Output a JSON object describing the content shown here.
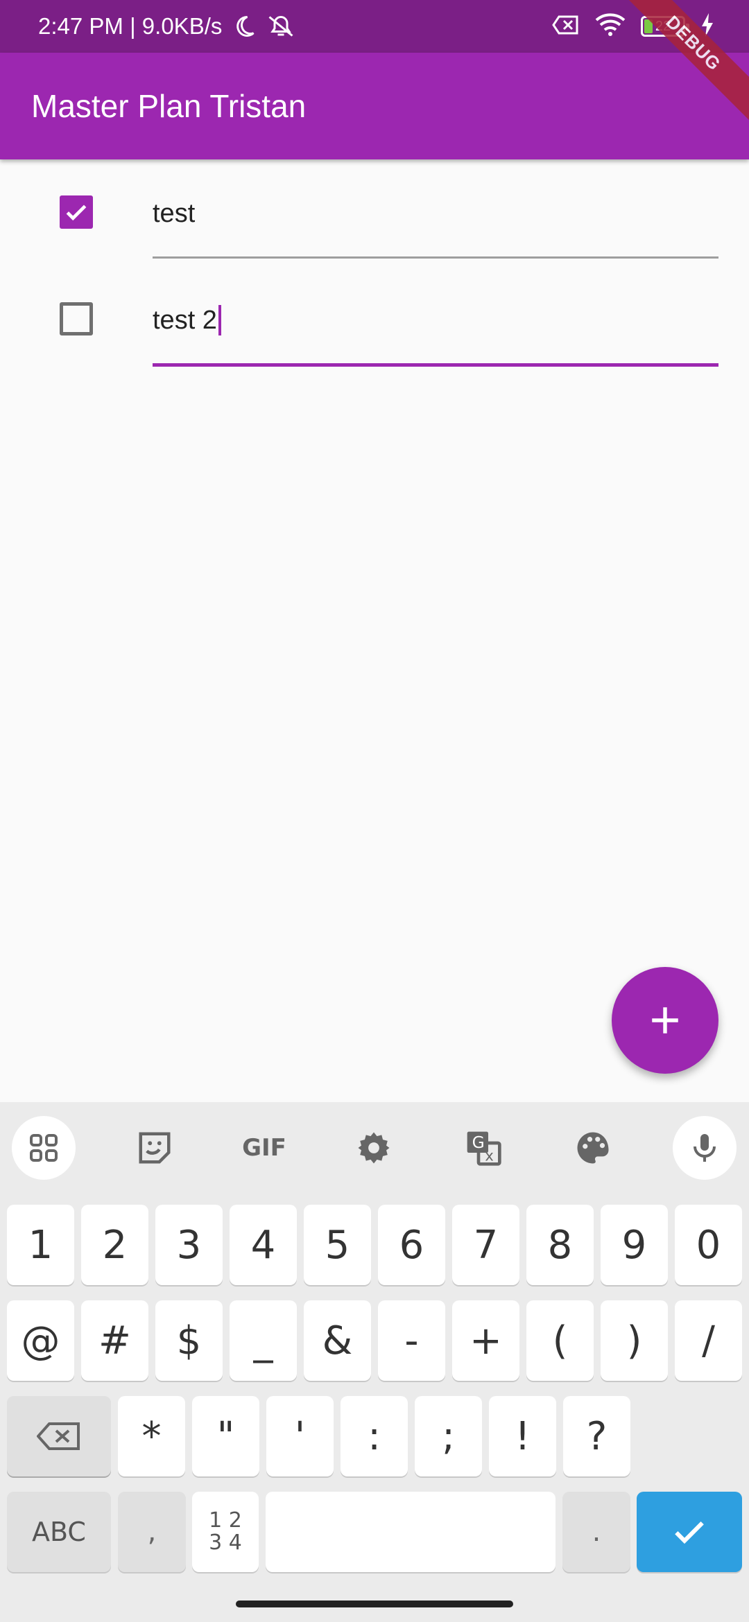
{
  "status_bar": {
    "time_info": "2:47 PM | 9.0KB/s",
    "battery_level": "22",
    "icons": [
      "moon-icon",
      "bell-off-icon",
      "sim-off-icon",
      "wifi-icon",
      "battery-icon",
      "charging-bolt-icon"
    ]
  },
  "debug_banner": "DEBUG",
  "app_bar": {
    "title": "Master Plan Tristan"
  },
  "todos": [
    {
      "text": "test",
      "checked": true
    },
    {
      "text": "test 2",
      "checked": false
    }
  ],
  "fab": {
    "label": "+",
    "icon": "add-icon"
  },
  "keyboard": {
    "toolbar_icons": [
      "apps-grid-icon",
      "sticker-icon",
      "gif-icon",
      "settings-icon",
      "translate-icon",
      "palette-icon",
      "microphone-icon"
    ],
    "gif_label": "GIF",
    "row1": [
      "1",
      "2",
      "3",
      "4",
      "5",
      "6",
      "7",
      "8",
      "9",
      "0"
    ],
    "row2": [
      "@",
      "#",
      "$",
      "_",
      "&",
      "-",
      "+",
      "(",
      ")",
      "/"
    ],
    "row3": [
      "=\\<",
      "*",
      "\"",
      "'",
      ":",
      ";",
      "!",
      "?"
    ],
    "row4": {
      "abc": "ABC",
      "comma": ",",
      "numgrid_top": "1 2",
      "numgrid_bottom": "3 4",
      "period": "."
    }
  },
  "colors": {
    "primary": "#9c27b0",
    "status_bar": "#7b1f86",
    "enter_key": "#2e9fe0"
  }
}
